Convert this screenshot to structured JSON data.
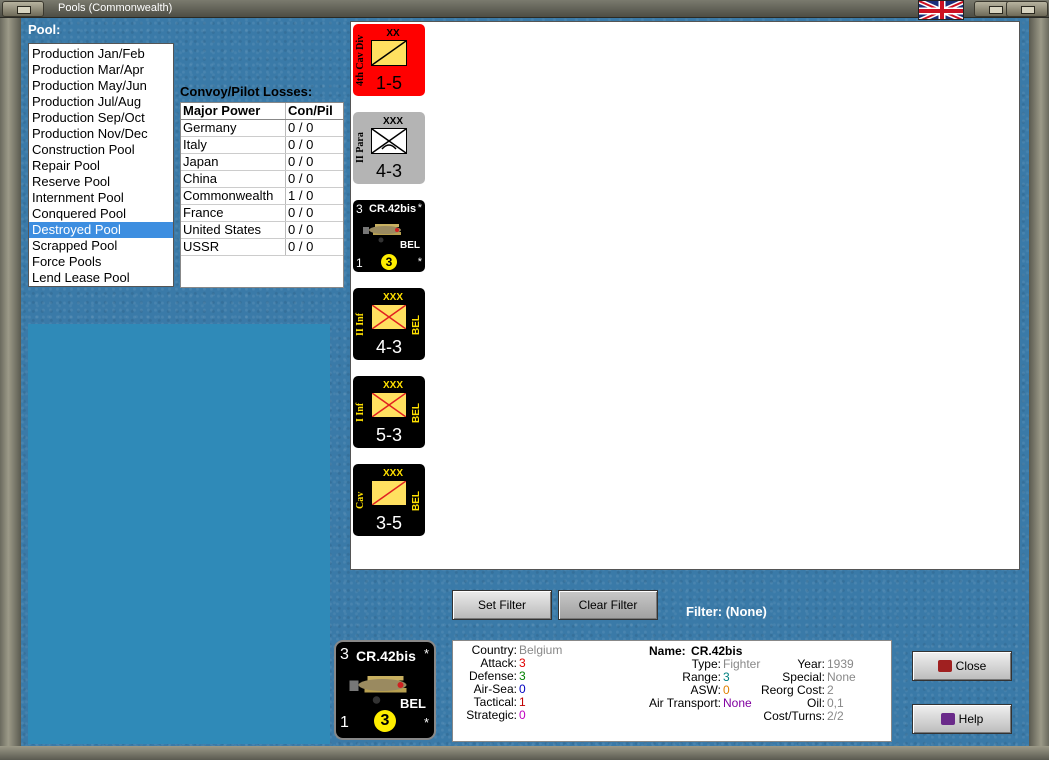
{
  "window": {
    "title": "Pools (Commonwealth)"
  },
  "pool": {
    "label": "Pool:",
    "items": [
      "Production Jan/Feb",
      "Production Mar/Apr",
      "Production May/Jun",
      "Production Jul/Aug",
      "Production Sep/Oct",
      "Production Nov/Dec",
      "Construction Pool",
      "Repair Pool",
      "Reserve Pool",
      "Internment Pool",
      "Conquered Pool",
      "Destroyed Pool",
      "Scrapped Pool",
      "Force Pools",
      "Lend Lease Pool"
    ],
    "selected": "Destroyed Pool"
  },
  "convoy": {
    "label": "Convoy/Pilot Losses:",
    "headers": [
      "Major Power",
      "Con/Pil"
    ],
    "rows": [
      [
        "Germany",
        "0 / 0"
      ],
      [
        "Italy",
        "0 / 0"
      ],
      [
        "Japan",
        "0 / 0"
      ],
      [
        "China",
        "0 / 0"
      ],
      [
        "Commonwealth",
        "1 / 0"
      ],
      [
        "France",
        "0 / 0"
      ],
      [
        "United States",
        "0 / 0"
      ],
      [
        "USSR",
        "0 / 0"
      ]
    ]
  },
  "units": [
    {
      "side": "4th Cav Div",
      "size": "XX",
      "strength": "1-5"
    },
    {
      "side": "II Para",
      "size": "XXX",
      "strength": "4-3"
    },
    {
      "air_top_left": "3",
      "name": "CR.42bis",
      "nation": "BEL",
      "bottom_left": "1",
      "circle": "3",
      "star": "*"
    },
    {
      "side": "II Inf",
      "size": "XXX",
      "nation": "BEL",
      "strength": "4-3"
    },
    {
      "side": "I Inf",
      "size": "XXX",
      "nation": "BEL",
      "strength": "5-3"
    },
    {
      "side": "Cav",
      "size": "XXX",
      "nation": "BEL",
      "strength": "3-5"
    }
  ],
  "filter": {
    "set_label": "Set Filter",
    "clear_label": "Clear Filter",
    "status": "Filter:  (None)"
  },
  "detail": {
    "counter": {
      "top_left": "3",
      "name": "CR.42bis",
      "nation": "BEL",
      "bottom_left": "1",
      "circle": "3",
      "star": "*"
    },
    "col1": [
      {
        "k": "Country:",
        "v": "Belgium",
        "color": "#888888"
      },
      {
        "k": "Attack:",
        "v": "3",
        "color": "#e00000"
      },
      {
        "k": "Defense:",
        "v": "3",
        "color": "#008000"
      },
      {
        "k": "Air-Sea:",
        "v": "0",
        "color": "#0000c0"
      },
      {
        "k": "Tactical:",
        "v": "1",
        "color": "#c00000"
      },
      {
        "k": "Strategic:",
        "v": "0",
        "color": "#c000c0"
      }
    ],
    "name_key": "Name:",
    "name_val": "CR.42bis",
    "col2": [
      {
        "k": "Type:",
        "v": "Fighter",
        "color": "#888888"
      },
      {
        "k": "Range:",
        "v": "3",
        "color": "#008080"
      },
      {
        "k": "ASW:",
        "v": "0",
        "color": "#e08000"
      },
      {
        "k": "Air Transport:",
        "v": "None",
        "color": "#8000a0"
      }
    ],
    "col3": [
      {
        "k": "Year:",
        "v": "1939",
        "color": "#888888"
      },
      {
        "k": "Special:",
        "v": "None",
        "color": "#888888"
      },
      {
        "k": "Reorg Cost:",
        "v": "2",
        "color": "#888888"
      },
      {
        "k": "Oil:",
        "v": "0,1",
        "color": "#888888"
      },
      {
        "k": "Cost/Turns:",
        "v": "2/2",
        "color": "#888888"
      }
    ]
  },
  "actions": {
    "close_label": "Close",
    "help_label": "Help"
  },
  "colors": {
    "selection": "#3d8ee0",
    "counter_black": "#000000",
    "counter_red": "#ff0000",
    "counter_grey": "#b4b4b4",
    "unit_box": "#ffe060"
  }
}
